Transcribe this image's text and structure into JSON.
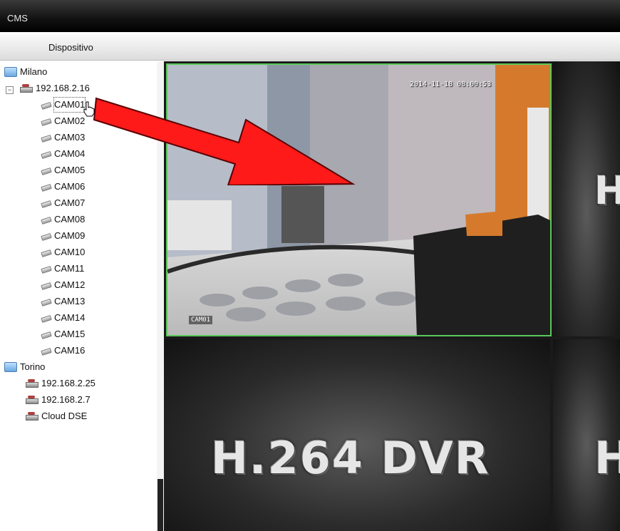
{
  "app": {
    "title": "CMS"
  },
  "menu": {
    "device": "Dispositivo"
  },
  "tree": {
    "site1": "Milano",
    "dvr1": "192.168.2.16",
    "cameras": [
      "CAM01",
      "CAM02",
      "CAM03",
      "CAM04",
      "CAM05",
      "CAM06",
      "CAM07",
      "CAM08",
      "CAM09",
      "CAM10",
      "CAM11",
      "CAM12",
      "CAM13",
      "CAM14",
      "CAM15",
      "CAM16"
    ],
    "site2": "Torino",
    "dvr2": "192.168.2.25",
    "dvr3": "192.168.2.7",
    "dvr4": "Cloud DSE"
  },
  "video": {
    "timestamp": "2014-11-18 08:00:53",
    "camera_label": "CAM01"
  },
  "placeholder_logo": "H.264 DVR",
  "colors": {
    "selected_border": "#5ac85a",
    "arrow": "#ff1a1a"
  }
}
